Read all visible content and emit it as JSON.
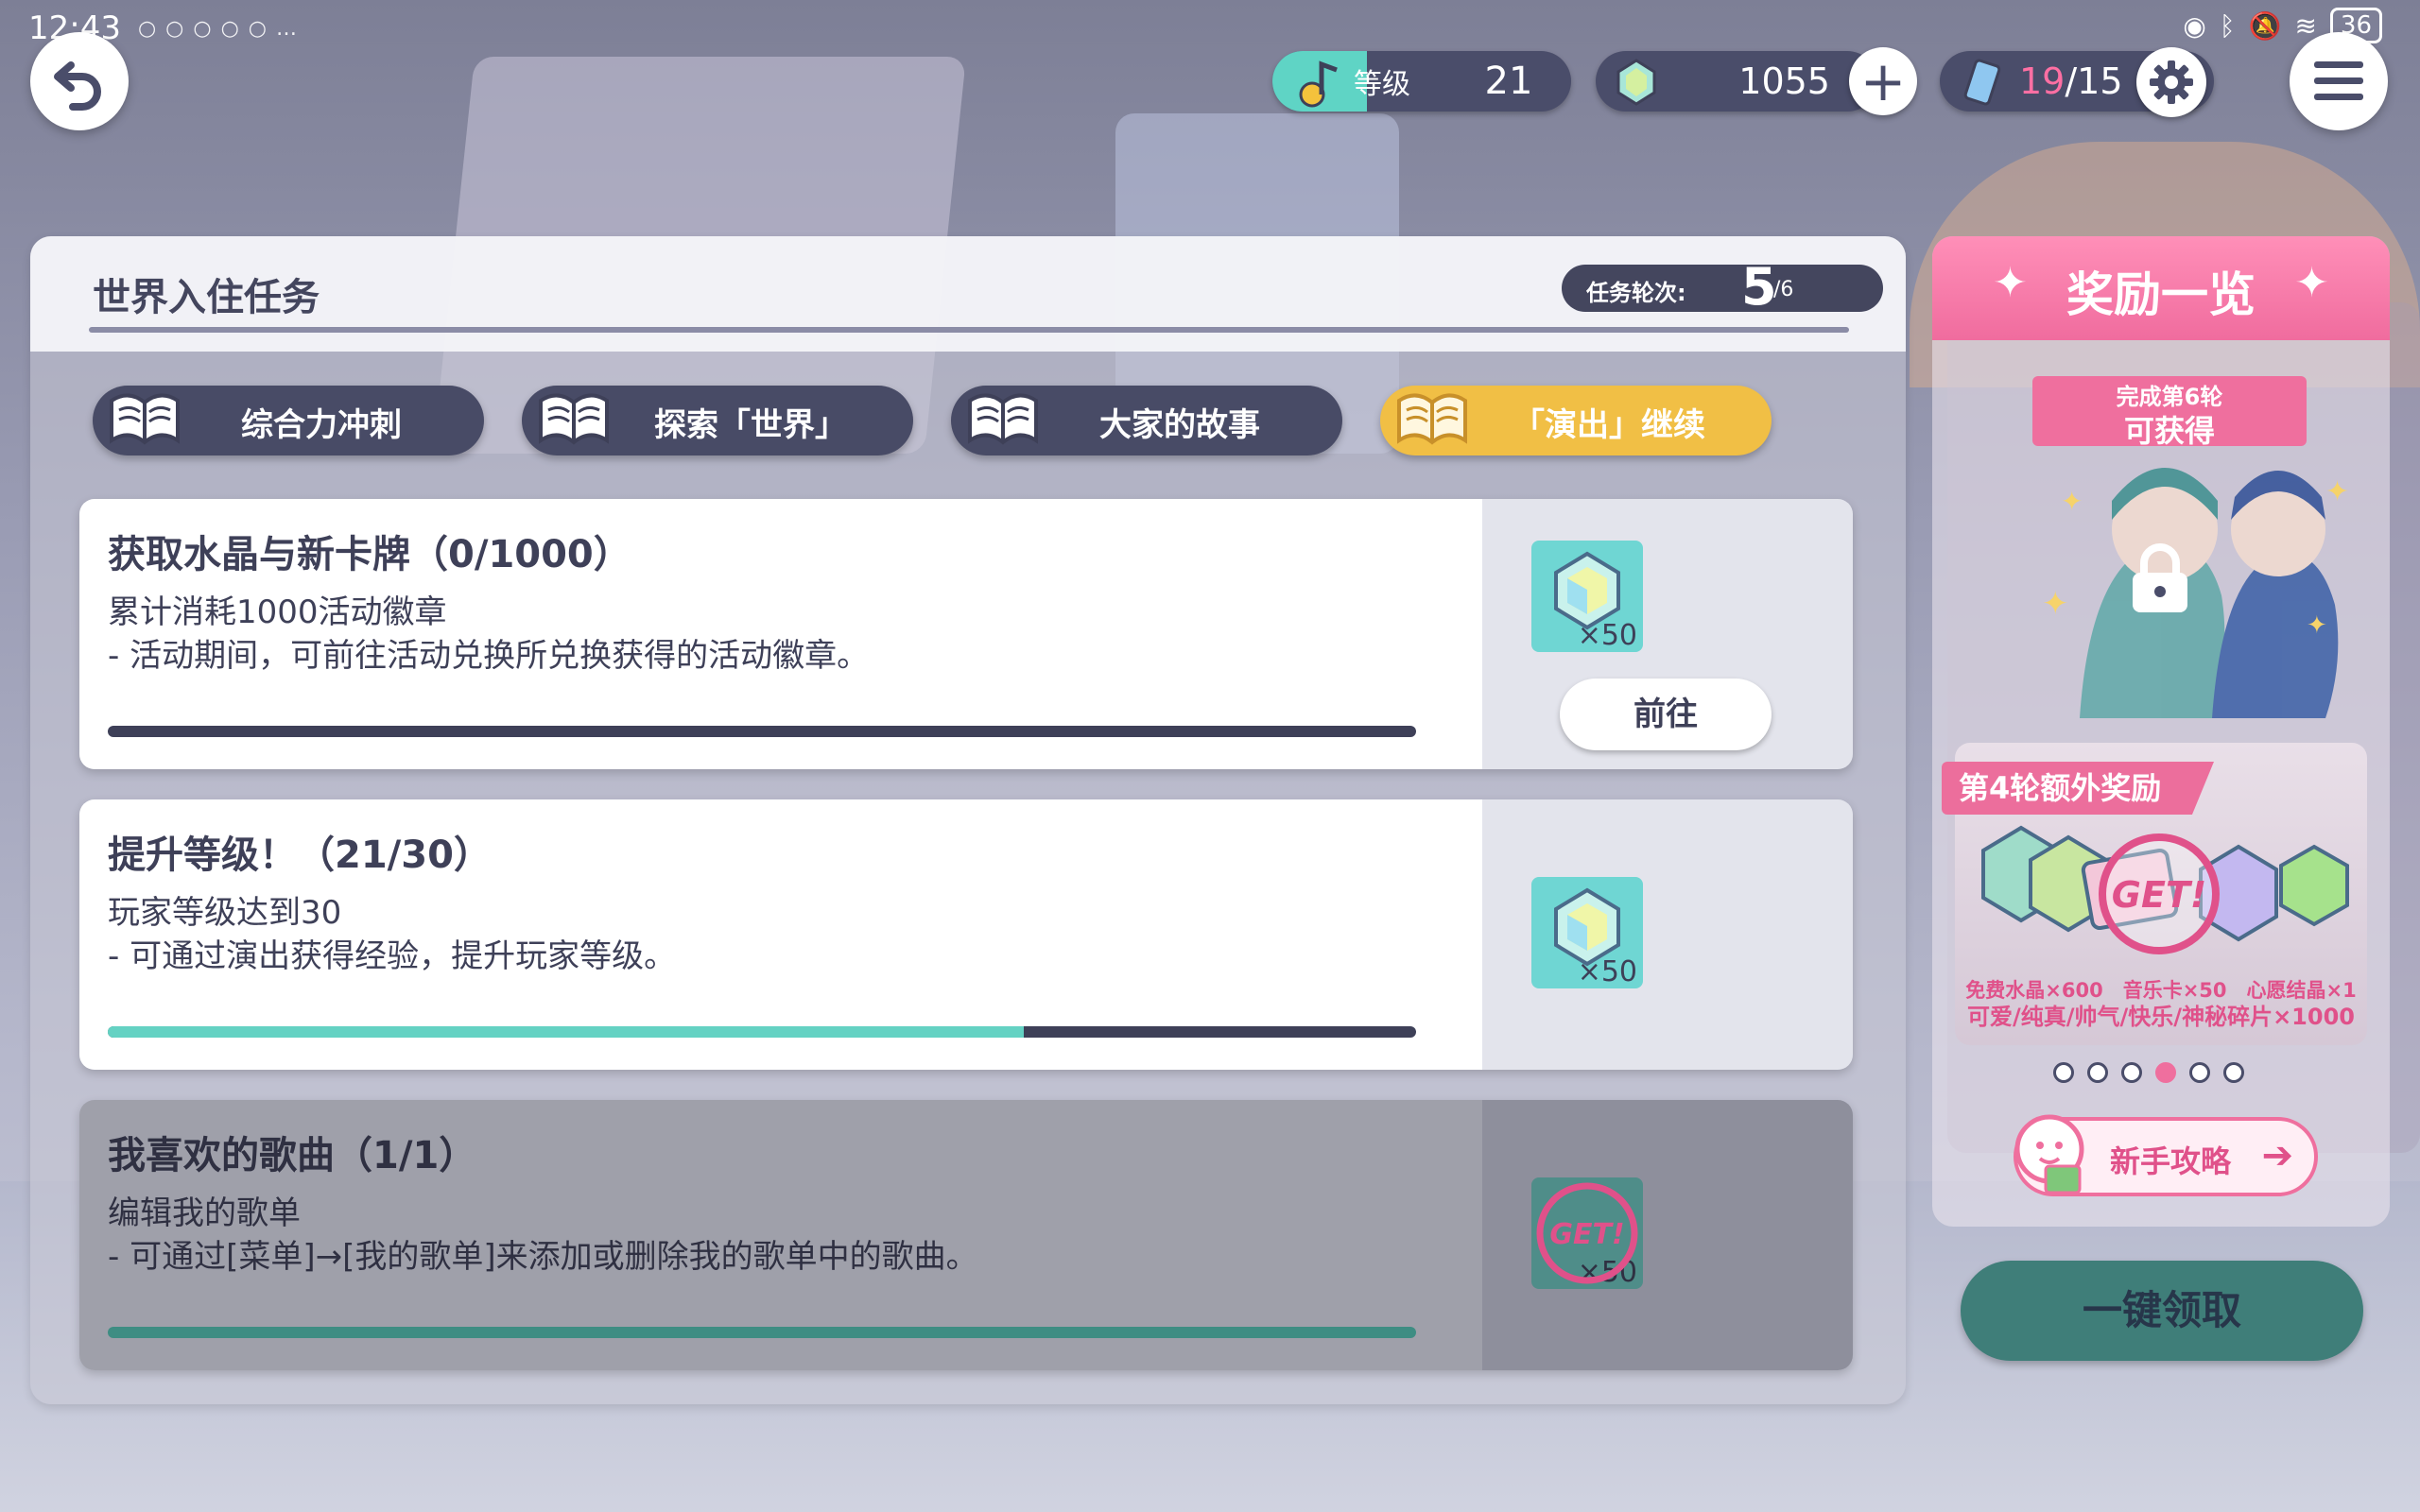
{
  "status_bar": {
    "time": "12:43",
    "battery": "36"
  },
  "currency": {
    "level_label": "等级",
    "level_value": "21",
    "crystal_value": "1055",
    "ticket_current": "19",
    "ticket_total": "/15"
  },
  "panel": {
    "title": "世界入住任务",
    "round_label": "任务轮次:",
    "round_current": "5",
    "round_total": "/6"
  },
  "tabs": [
    {
      "label": "综合力冲刺",
      "active": false
    },
    {
      "label": "探索「世界」",
      "active": false
    },
    {
      "label": "大家的故事",
      "active": false
    },
    {
      "label": "「演出」继续",
      "active": true
    }
  ],
  "missions": [
    {
      "title": "获取水晶与新卡牌（0/1000）",
      "desc": "累计消耗1000活动徽章",
      "note": "- 活动期间，可前往活动兑换所兑换获得的活动徽章。",
      "progress": 0,
      "reward_qty": "×50",
      "action_label": "前往",
      "completed": false
    },
    {
      "title": "提升等级！（21/30）",
      "desc": "玩家等级达到30",
      "note": "- 可通过演出获得经验，提升玩家等级。",
      "progress": 0.7,
      "reward_qty": "×50",
      "completed": false
    },
    {
      "title": "我喜欢的歌曲（1/1）",
      "desc": "编辑我的歌单",
      "note": "- 可通过[菜单]→[我的歌单]来添加或删除我的歌单中的歌曲。",
      "progress": 1,
      "reward_qty": "×50",
      "reward_stamp": "GET!",
      "completed": true
    }
  ],
  "reward_panel": {
    "title": "奖励一览",
    "ribbon_top": "完成第6轮",
    "ribbon_main": "可获得",
    "bonus_tag": "第4轮额外奖励",
    "bonus_stamp": "GET!",
    "bonus_line1": "免费水晶×600　音乐卡×50　心愿结晶×1",
    "bonus_line2": "可爱/纯真/帅气/快乐/神秘碎片×1000",
    "page_count": 6,
    "page_active": 4,
    "guide_label": "新手攻略",
    "claim_label": "一键领取"
  },
  "colors": {
    "accent_pink": "#ef6f9e",
    "accent_teal": "#64d2c3",
    "tab_active": "#f1bf45",
    "dark_navy": "#484b66"
  }
}
